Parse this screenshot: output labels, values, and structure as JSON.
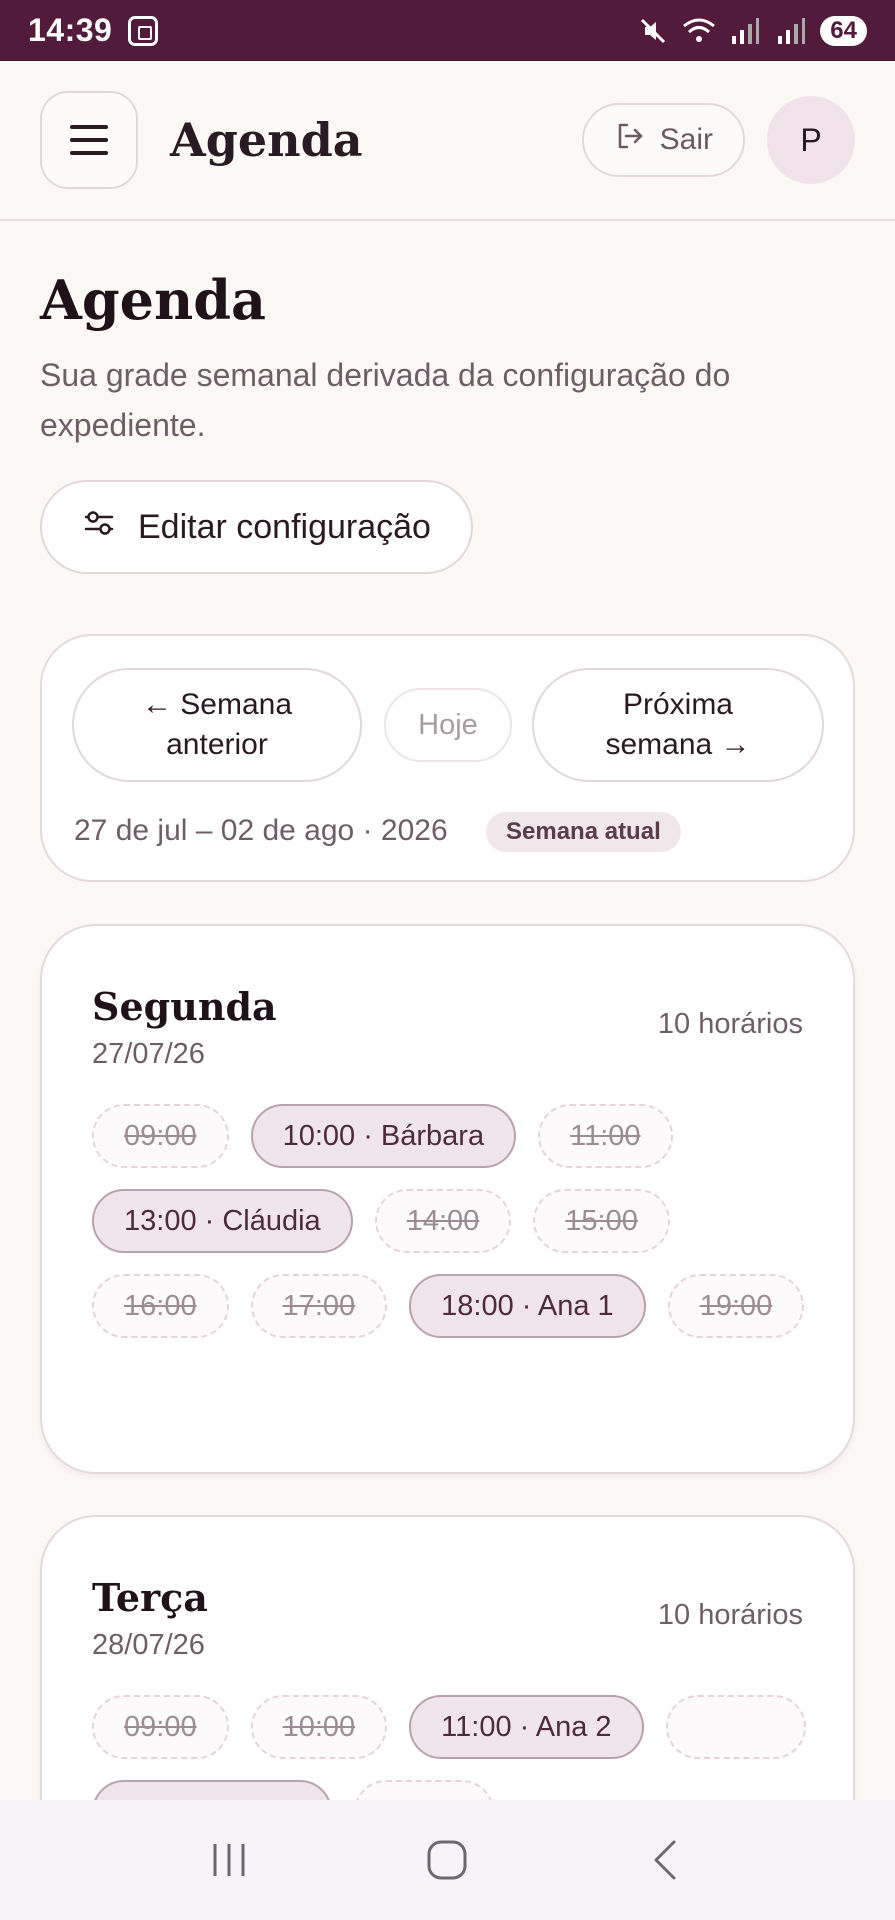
{
  "status_bar": {
    "time": "14:39",
    "battery": "64"
  },
  "header": {
    "title": "Agenda",
    "logout_label": "Sair",
    "avatar_initial": "P"
  },
  "page": {
    "title": "Agenda",
    "subtitle": "Sua grade semanal derivada da configuração do expediente.",
    "edit_config_label": "Editar configuração"
  },
  "week_nav": {
    "prev_label_line1": "← Semana",
    "prev_label_line2": "anterior",
    "today_label": "Hoje",
    "next_label_line1": "Próxima",
    "next_label_line2": "semana →",
    "range": "27 de jul – 02 de ago · 2026",
    "badge": "Semana atual"
  },
  "days": [
    {
      "name": "Segunda",
      "date": "27/07/26",
      "count": "10 horários",
      "slots": [
        {
          "label": "09:00",
          "booked": false
        },
        {
          "label": "10:00 · Bárbara",
          "booked": true
        },
        {
          "label": "11:00",
          "booked": false
        },
        {
          "label": "13:00 · Cláudia",
          "booked": true
        },
        {
          "label": "14:00",
          "booked": false
        },
        {
          "label": "15:00",
          "booked": false
        },
        {
          "label": "16:00",
          "booked": false
        },
        {
          "label": "17:00",
          "booked": false
        },
        {
          "label": "18:00 · Ana 1",
          "booked": true
        },
        {
          "label": "19:00",
          "booked": false
        }
      ]
    },
    {
      "name": "Terça",
      "date": "28/07/26",
      "count": "10 horários",
      "slots": [
        {
          "label": "09:00",
          "booked": false
        },
        {
          "label": "10:00",
          "booked": false
        },
        {
          "label": "11:00 · Ana 2",
          "booked": true
        },
        {
          "label": "",
          "booked": false
        },
        {
          "label": "",
          "booked": true
        },
        {
          "label": "",
          "booked": false
        }
      ]
    }
  ],
  "colors": {
    "status_bar": "#521b3b",
    "background": "#fcf8f6",
    "booked_slot": "#f0e5ea",
    "accent_text": "#4e2a3c"
  },
  "icons": {
    "menu": "menu-icon",
    "logout": "logout-icon",
    "settings": "sliders-icon"
  }
}
